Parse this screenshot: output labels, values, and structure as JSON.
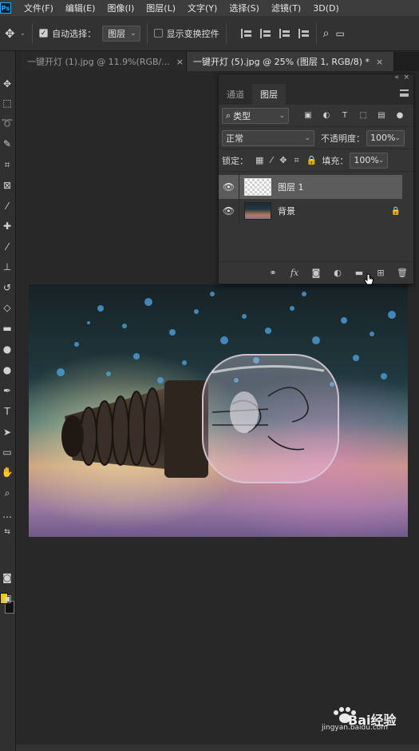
{
  "app": {
    "logo_text": "Ps"
  },
  "menubar": {
    "items": [
      "文件(F)",
      "编辑(E)",
      "图像(I)",
      "图层(L)",
      "文字(Y)",
      "选择(S)",
      "滤镜(T)",
      "3D(D)"
    ]
  },
  "options": {
    "auto_select_label": "自动选择：",
    "auto_select_checked": true,
    "auto_select_target": "图层",
    "show_transform_label": "显示变换控件",
    "show_transform_checked": false
  },
  "tabs": [
    {
      "label": "一键开灯 (1).jpg @ 11.9%(RGB/...",
      "close": "×",
      "active": false
    },
    {
      "label": "一键开灯 (5).jpg @ 25% (图层 1, RGB/8) *",
      "close": "×",
      "active": true
    }
  ],
  "panel": {
    "tabs": [
      "通道",
      "图层"
    ],
    "active_tab": "图层",
    "filter_kind": "类型",
    "blend_mode": "正常",
    "opacity_label": "不透明度：",
    "opacity_value": "100%",
    "lock_label": "锁定：",
    "fill_label": "填充：",
    "fill_value": "100%",
    "layers": [
      {
        "name": "图层 1",
        "selected": true,
        "locked": false,
        "thumb": "transparent"
      },
      {
        "name": "背景",
        "selected": false,
        "locked": true,
        "thumb": "photo"
      }
    ]
  },
  "colors": {
    "foreground": "#f2c400",
    "background": "#111111"
  },
  "watermark": {
    "brand": "Bai经验",
    "url": "jingyan.baidu.com"
  }
}
